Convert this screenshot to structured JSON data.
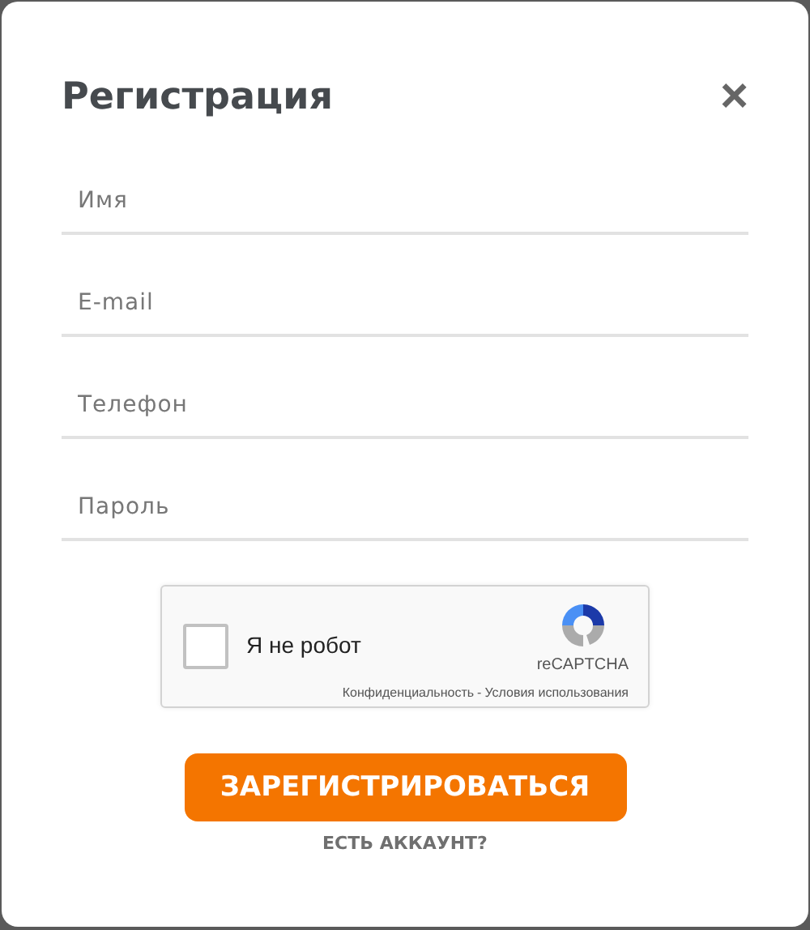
{
  "dialog": {
    "title": "Регистрация",
    "close": "×"
  },
  "fields": [
    {
      "placeholder": "Имя"
    },
    {
      "placeholder": "E-mail"
    },
    {
      "placeholder": "Телефон"
    },
    {
      "placeholder": "Пароль"
    }
  ],
  "captcha": {
    "label": "Я не робот",
    "checked": false,
    "brand": "reCAPTCHA",
    "links": [
      "Конфиденциальность",
      "Условия использования"
    ],
    "separator": "-"
  },
  "submit": "ЗАРЕГИСТРИРОВАТЬСЯ",
  "login_link": "ЕСТЬ АККАУНТ?"
}
